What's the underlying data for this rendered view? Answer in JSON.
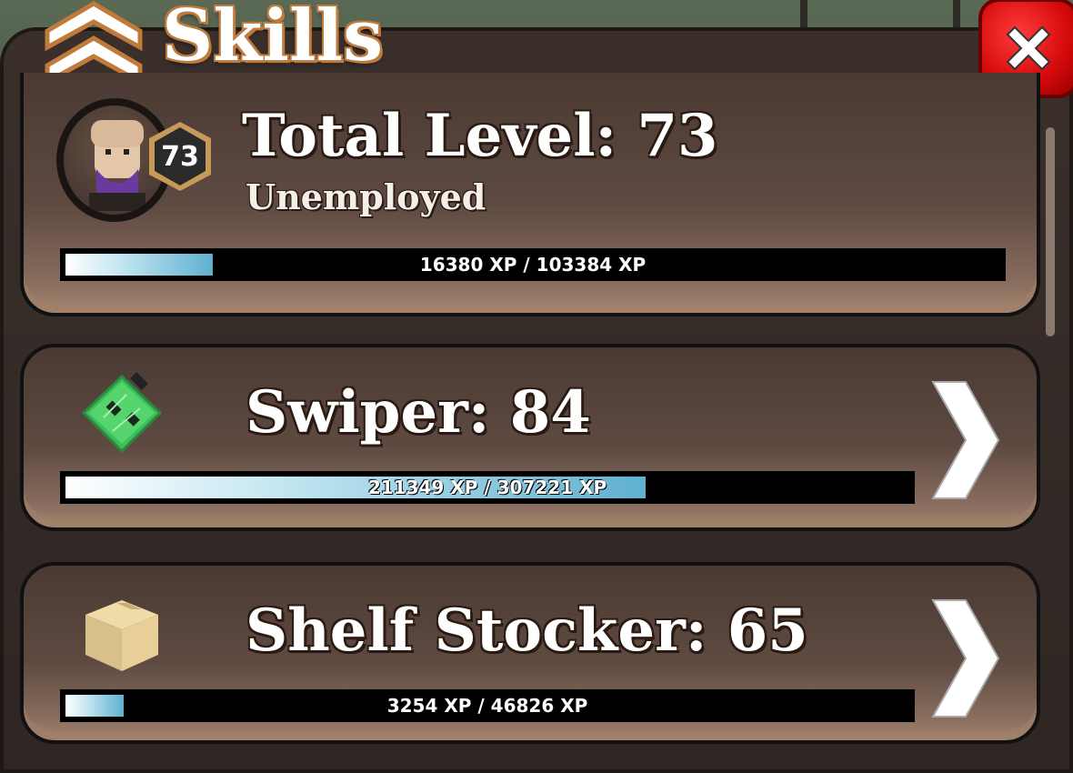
{
  "window": {
    "title": "Skills"
  },
  "total": {
    "label": "Total Level: 73",
    "job": "Unemployed",
    "badge_level": "73",
    "xp_text": "16380 XP / 103384 XP",
    "progress": 0.158
  },
  "skills": [
    {
      "label": "Swiper: 84",
      "xp_text": "211349 XP / 307221 XP",
      "progress": 0.688,
      "icon": "circuit-board-icon"
    },
    {
      "label": "Shelf Stocker: 65",
      "xp_text": "3254 XP / 46826 XP",
      "progress": 0.069,
      "icon": "cardboard-box-icon"
    }
  ],
  "colors": {
    "accent_orange": "#c07a3a",
    "close_red": "#d40a0a",
    "xp_fill": "#5fb0d0"
  }
}
